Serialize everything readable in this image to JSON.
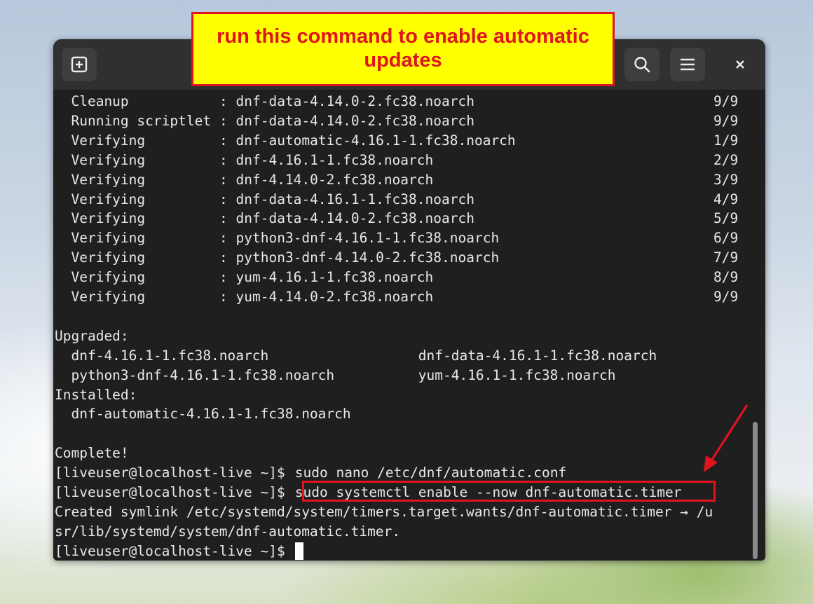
{
  "annotation": {
    "callout_text": "run this command to enable automatic updates",
    "accent": "#e0141e",
    "callout_bg": "#ffff00"
  },
  "headerbar": {
    "new_tab_icon": "new-tab-icon",
    "search_icon": "search-icon",
    "menu_icon": "hamburger-menu-icon",
    "close_icon": "close-icon"
  },
  "terminal": {
    "transaction_rows": [
      {
        "label": "  Cleanup",
        "sep": ":",
        "pkg": "dnf-data-4.14.0-2.fc38.noarch",
        "count": "9/9"
      },
      {
        "label": "  Running scriptlet",
        "sep": ":",
        "pkg": "dnf-data-4.14.0-2.fc38.noarch",
        "count": "9/9"
      },
      {
        "label": "  Verifying",
        "sep": ":",
        "pkg": "dnf-automatic-4.16.1-1.fc38.noarch",
        "count": "1/9"
      },
      {
        "label": "  Verifying",
        "sep": ":",
        "pkg": "dnf-4.16.1-1.fc38.noarch",
        "count": "2/9"
      },
      {
        "label": "  Verifying",
        "sep": ":",
        "pkg": "dnf-4.14.0-2.fc38.noarch",
        "count": "3/9"
      },
      {
        "label": "  Verifying",
        "sep": ":",
        "pkg": "dnf-data-4.16.1-1.fc38.noarch",
        "count": "4/9"
      },
      {
        "label": "  Verifying",
        "sep": ":",
        "pkg": "dnf-data-4.14.0-2.fc38.noarch",
        "count": "5/9"
      },
      {
        "label": "  Verifying",
        "sep": ":",
        "pkg": "python3-dnf-4.16.1-1.fc38.noarch",
        "count": "6/9"
      },
      {
        "label": "  Verifying",
        "sep": ":",
        "pkg": "python3-dnf-4.14.0-2.fc38.noarch",
        "count": "7/9"
      },
      {
        "label": "  Verifying",
        "sep": ":",
        "pkg": "yum-4.16.1-1.fc38.noarch",
        "count": "8/9"
      },
      {
        "label": "  Verifying",
        "sep": ":",
        "pkg": "yum-4.14.0-2.fc38.noarch",
        "count": "9/9"
      }
    ],
    "upgraded_header": "Upgraded:",
    "upgraded": [
      [
        "dnf-4.16.1-1.fc38.noarch",
        "dnf-data-4.16.1-1.fc38.noarch"
      ],
      [
        "python3-dnf-4.16.1-1.fc38.noarch",
        "yum-4.16.1-1.fc38.noarch"
      ]
    ],
    "installed_header": "Installed:",
    "installed": [
      "dnf-automatic-4.16.1-1.fc38.noarch"
    ],
    "complete": "Complete!",
    "prompt": "[liveuser@localhost-live ~]$ ",
    "cmd1": "sudo nano /etc/dnf/automatic.conf",
    "cmd2": "sudo systemctl enable --now dnf-automatic.timer",
    "output1": "Created symlink /etc/systemd/system/timers.target.wants/dnf-automatic.timer → /u",
    "output2": "sr/lib/systemd/system/dnf-automatic.timer."
  }
}
